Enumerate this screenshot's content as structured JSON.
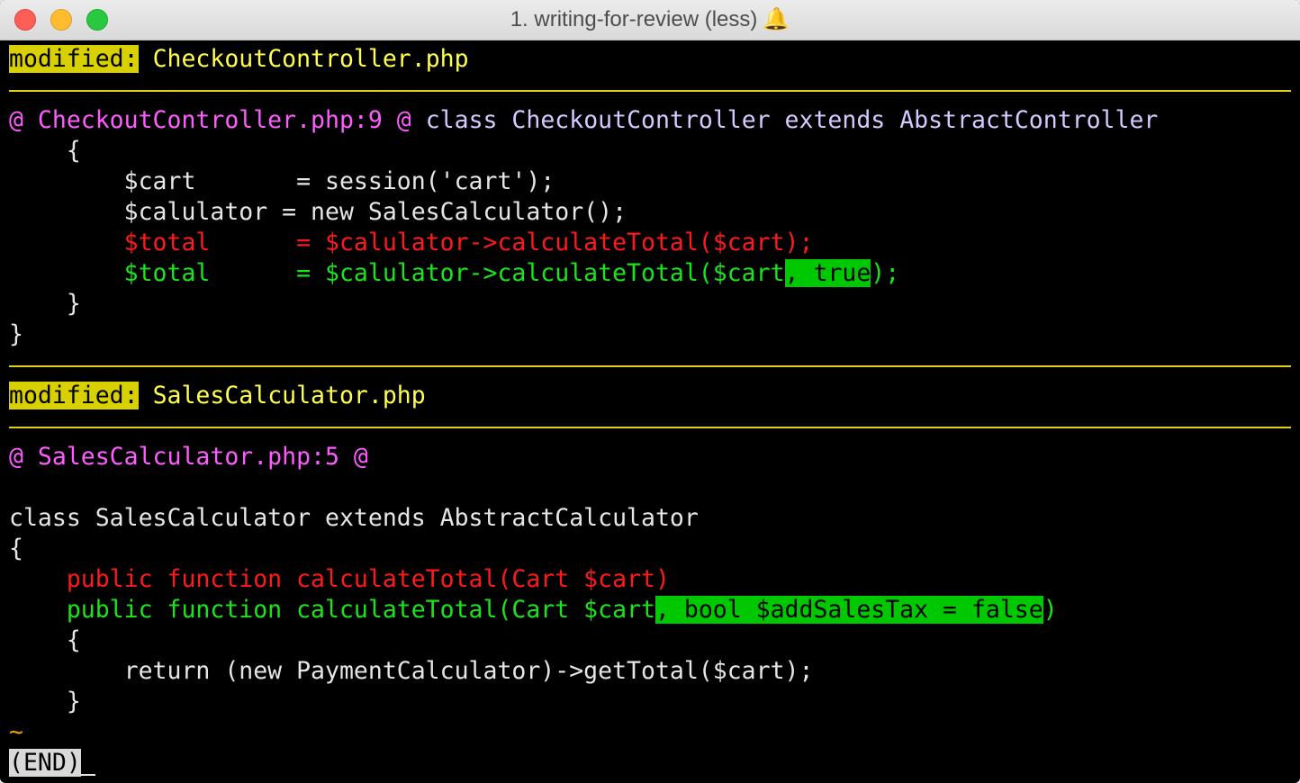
{
  "window": {
    "title": "1. writing-for-review (less)",
    "bell": "🔔"
  },
  "diff": {
    "file1": {
      "label": "modified:",
      "name": "CheckoutController.php",
      "hunk": "@ CheckoutController.php:9 @",
      "hunk_context": "class CheckoutController extends AbstractController",
      "lines": {
        "open": "    {",
        "cart": "        $cart       = session('cart');",
        "calc": "        $calulator = new SalesCalculator();",
        "del": "        $total      = $calulator->calculateTotal($cart);",
        "add_pre": "        $total      = $calulator->calculateTotal($cart",
        "add_hl": ", true",
        "add_post": ");",
        "close_inner": "    }",
        "close_outer": "}"
      }
    },
    "file2": {
      "label": "modified:",
      "name": "SalesCalculator.php",
      "hunk": "@ SalesCalculator.php:5 @",
      "lines": {
        "blank": "",
        "class": "class SalesCalculator extends AbstractCalculator",
        "open": "{",
        "del": "    public function calculateTotal(Cart $cart)",
        "add_pre": "    public function calculateTotal(Cart $cart",
        "add_hl": ", bool $addSalesTax = false",
        "add_post": ")",
        "body_open": "    {",
        "ret": "        return (new PaymentCalculator)->getTotal($cart);",
        "body_close": "    }"
      }
    },
    "tilde": "~",
    "end": "(END)"
  }
}
